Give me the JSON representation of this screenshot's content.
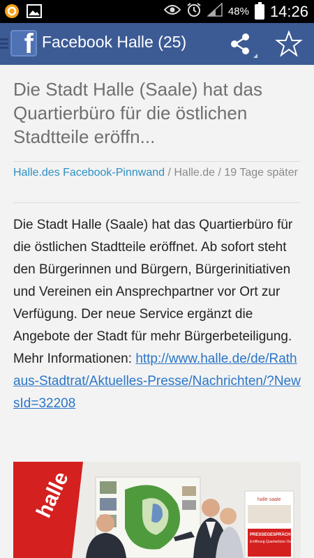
{
  "status_bar": {
    "battery_percent": "48%",
    "time": "14:26",
    "icons": [
      "app-notification-icon",
      "image-icon",
      "eye-icon",
      "alarm-icon",
      "signal-icon",
      "battery-icon"
    ]
  },
  "app_bar": {
    "title": "Facebook Halle (25)",
    "icons": [
      "menu-icon",
      "facebook-logo-icon",
      "share-icon",
      "star-icon"
    ],
    "color": "#3c5b95"
  },
  "article": {
    "title": "Die Stadt Halle (Saale) hat das Quartierbüro für die östlichen Stadtteile eröffn...",
    "meta": {
      "source_link": "Halle.des Facebook-Pinnwand",
      "separator1": " / ",
      "site": "Halle.de",
      "separator2": " / ",
      "age": "19 Tage später"
    },
    "body": "Die Stadt Halle (Saale) hat das Quartierbüro für die östlichen Stadtteile eröffnet. Ab sofort steht den Bürgerinnen und Bürgern, Bürgerinitiativen und Vereinen ein Ansprechpartner vor Ort zur Verfügung. Der neue Service ergänzt die Angebote der Stadt für mehr Bürgerbeteiligung. Mehr Informationen: ",
    "link": "http://www.halle.de/de/Rathaus-Stadtrat/Aktuelles-Presse/Nachrichten/?NewsId=32208",
    "photo": {
      "banner_text": "halle",
      "poster_header": "halle saale",
      "poster_title": "PRESSEGESPRÄCH",
      "poster_subtitle": "Eröffnung Quartierbüro Ost"
    }
  },
  "colors": {
    "link": "#2a76c8",
    "source_link": "#2b8fc3",
    "title_gray": "#6f6f6f"
  }
}
